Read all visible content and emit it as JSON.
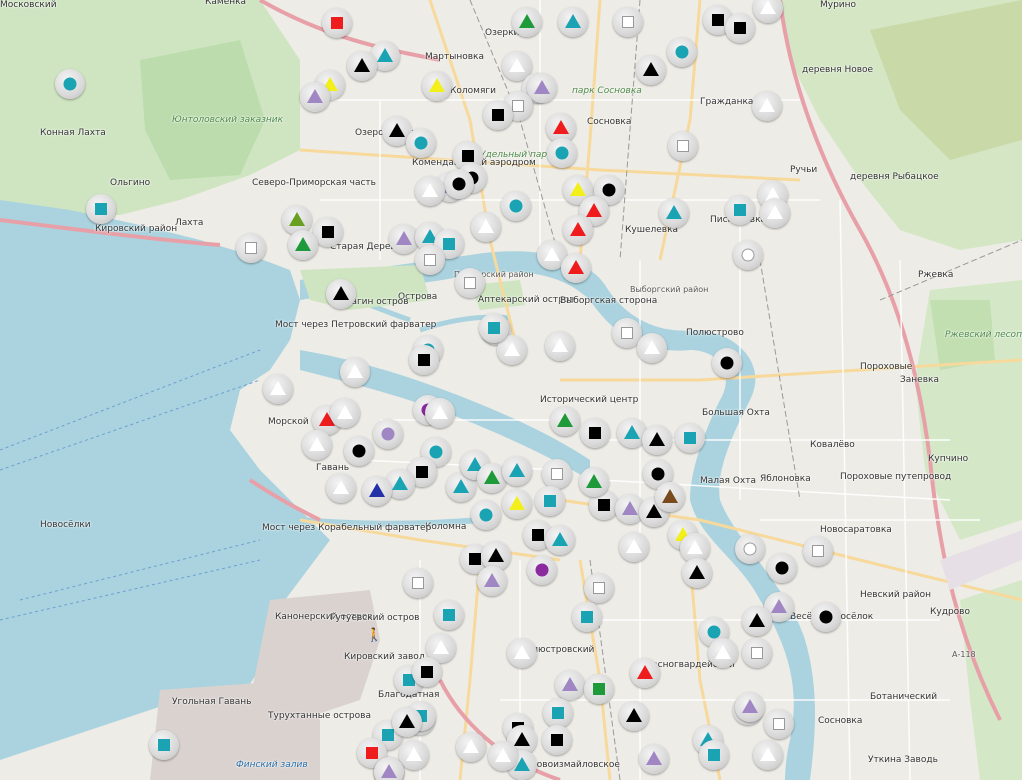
{
  "palette": {
    "teal": "#1aa3b3",
    "black": "#000000",
    "white": "#ffffff",
    "red": "#ee1c1c",
    "green": "#1f9a3a",
    "yellow": "#f2ef1a",
    "lavender": "#a087c4",
    "purple": "#8b2a9e",
    "blue": "#2430a8",
    "brown": "#7a4a1f",
    "olive": "#6aa022"
  },
  "labels": [
    {
      "text": "Каменка",
      "cls": ""
    },
    {
      "text": "Мурино",
      "cls": ""
    },
    {
      "text": "Озерки",
      "cls": ""
    },
    {
      "text": "деревня Новое",
      "cls": ""
    },
    {
      "text": "Мартыновка",
      "cls": ""
    },
    {
      "text": "Коломяги",
      "cls": ""
    },
    {
      "text": "парк Сосновка",
      "cls": "green"
    },
    {
      "text": "Гражданка",
      "cls": ""
    },
    {
      "text": "Конная Лахта",
      "cls": ""
    },
    {
      "text": "Юнтоловский заказник",
      "cls": "green"
    },
    {
      "text": "Озеро Долгое",
      "cls": ""
    },
    {
      "text": "Сосновка",
      "cls": ""
    },
    {
      "text": "Удельный парк",
      "cls": "green"
    },
    {
      "text": "Комендантский аэродром",
      "cls": ""
    },
    {
      "text": "Ручьи",
      "cls": ""
    },
    {
      "text": "деревня Рыбацкое",
      "cls": ""
    },
    {
      "text": "Ольгино",
      "cls": ""
    },
    {
      "text": "Северо-Приморская часть",
      "cls": ""
    },
    {
      "text": "Лахта",
      "cls": ""
    },
    {
      "text": "Старая Деревня",
      "cls": ""
    },
    {
      "text": "Кушелевка",
      "cls": ""
    },
    {
      "text": "Пискарёвка",
      "cls": ""
    },
    {
      "text": "Ржевка",
      "cls": ""
    },
    {
      "text": "Острова",
      "cls": ""
    },
    {
      "text": "Аптекарский остров",
      "cls": ""
    },
    {
      "text": "Выборгская сторона",
      "cls": ""
    },
    {
      "text": "Полюстрово",
      "cls": ""
    },
    {
      "text": "Елагин остров",
      "cls": ""
    },
    {
      "text": "Мост через Петровский фарватер",
      "cls": ""
    },
    {
      "text": "Ржевский лесопарк",
      "cls": "green"
    },
    {
      "text": "Пороховые",
      "cls": ""
    },
    {
      "text": "Большая Охта",
      "cls": ""
    },
    {
      "text": "Морской",
      "cls": ""
    },
    {
      "text": "Гавань",
      "cls": ""
    },
    {
      "text": "Малая Охта",
      "cls": ""
    },
    {
      "text": "Яблоновка",
      "cls": ""
    },
    {
      "text": "Пороховые путепровод",
      "cls": ""
    },
    {
      "text": "Ковалёво",
      "cls": ""
    },
    {
      "text": "Коломна",
      "cls": ""
    },
    {
      "text": "Мост через Корабельный фарватер",
      "cls": ""
    },
    {
      "text": "Кудрово",
      "cls": ""
    },
    {
      "text": "Весёлый Посёлок",
      "cls": ""
    },
    {
      "text": "Канонерский остров",
      "cls": ""
    },
    {
      "text": "Гутуевский остров",
      "cls": ""
    },
    {
      "text": "Кировский завод",
      "cls": ""
    },
    {
      "text": "Новосаратовка",
      "cls": ""
    },
    {
      "text": "Угольная Гавань",
      "cls": ""
    },
    {
      "text": "Турухтанные острова",
      "cls": ""
    },
    {
      "text": "Сосновка",
      "cls": ""
    },
    {
      "text": "Уткина Заводь",
      "cls": ""
    },
    {
      "text": "Исторический центр",
      "cls": ""
    },
    {
      "text": "А-118",
      "cls": "road"
    },
    {
      "text": "Новосёлки",
      "cls": ""
    },
    {
      "text": "Финский залив",
      "cls": "water"
    },
    {
      "text": "Кировский район",
      "cls": ""
    },
    {
      "text": "Приморский район",
      "cls": "road"
    },
    {
      "text": "Выборгский район",
      "cls": "road"
    },
    {
      "text": "Ботанический",
      "cls": ""
    },
    {
      "text": "Купчино",
      "cls": ""
    },
    {
      "text": "Заневка",
      "cls": ""
    },
    {
      "text": "Полюстровский",
      "cls": ""
    },
    {
      "text": "Благодатная",
      "cls": ""
    },
    {
      "text": "Новоизмайловское",
      "cls": ""
    },
    {
      "text": "Невский район",
      "cls": ""
    },
    {
      "text": "Красногвардейский",
      "cls": ""
    },
    {
      "text": "Московский",
      "cls": ""
    }
  ],
  "markers": [
    {
      "shape": "square",
      "color": "red"
    },
    {
      "shape": "triangle",
      "color": "green"
    },
    {
      "shape": "triangle",
      "color": "teal"
    },
    {
      "shape": "square",
      "color": "white"
    },
    {
      "shape": "square",
      "color": "black"
    },
    {
      "shape": "square",
      "color": "black"
    },
    {
      "shape": "triangle",
      "color": "white"
    },
    {
      "shape": "circle",
      "color": "teal"
    },
    {
      "shape": "triangle",
      "color": "teal"
    },
    {
      "shape": "triangle",
      "color": "black"
    },
    {
      "shape": "triangle",
      "color": "yellow"
    },
    {
      "shape": "triangle",
      "color": "yellow"
    },
    {
      "shape": "triangle",
      "color": "white"
    },
    {
      "shape": "triangle",
      "color": "black"
    },
    {
      "shape": "circle",
      "color": "teal"
    },
    {
      "shape": "triangle",
      "color": "white"
    },
    {
      "shape": "triangle",
      "color": "lavender"
    },
    {
      "shape": "triangle",
      "color": "lavender"
    },
    {
      "shape": "square",
      "color": "white"
    },
    {
      "shape": "square",
      "color": "black"
    },
    {
      "shape": "triangle",
      "color": "white"
    },
    {
      "shape": "triangle",
      "color": "red"
    },
    {
      "shape": "triangle",
      "color": "black"
    },
    {
      "shape": "circle",
      "color": "teal"
    },
    {
      "shape": "circle",
      "color": "teal"
    },
    {
      "shape": "square",
      "color": "white"
    },
    {
      "shape": "square",
      "color": "black"
    },
    {
      "shape": "triangle",
      "color": "lavender"
    },
    {
      "shape": "circle",
      "color": "black"
    },
    {
      "shape": "circle",
      "color": "black"
    },
    {
      "shape": "triangle",
      "color": "yellow"
    },
    {
      "shape": "circle",
      "color": "black"
    },
    {
      "shape": "square",
      "color": "teal"
    },
    {
      "shape": "triangle",
      "color": "white"
    },
    {
      "shape": "circle",
      "color": "teal"
    },
    {
      "shape": "triangle",
      "color": "red"
    },
    {
      "shape": "triangle",
      "color": "teal"
    },
    {
      "shape": "square",
      "color": "teal"
    },
    {
      "shape": "triangle",
      "color": "white"
    },
    {
      "shape": "triangle",
      "color": "olive"
    },
    {
      "shape": "square",
      "color": "black"
    },
    {
      "shape": "triangle",
      "color": "green"
    },
    {
      "shape": "square",
      "color": "white"
    },
    {
      "shape": "triangle",
      "color": "lavender"
    },
    {
      "shape": "triangle",
      "color": "teal"
    },
    {
      "shape": "square",
      "color": "teal"
    },
    {
      "shape": "triangle",
      "color": "white"
    },
    {
      "shape": "triangle",
      "color": "red"
    },
    {
      "shape": "triangle",
      "color": "white"
    },
    {
      "shape": "triangle",
      "color": "red"
    },
    {
      "shape": "circle",
      "color": "white"
    },
    {
      "shape": "triangle",
      "color": "white"
    },
    {
      "shape": "square",
      "color": "white"
    },
    {
      "shape": "triangle",
      "color": "black"
    },
    {
      "shape": "circle",
      "color": "teal"
    },
    {
      "shape": "square",
      "color": "white"
    },
    {
      "shape": "square",
      "color": "white"
    },
    {
      "shape": "triangle",
      "color": "white"
    },
    {
      "shape": "square",
      "color": "black"
    },
    {
      "shape": "triangle",
      "color": "white"
    },
    {
      "shape": "circle",
      "color": "black"
    },
    {
      "shape": "triangle",
      "color": "white"
    },
    {
      "shape": "triangle",
      "color": "white"
    },
    {
      "shape": "square",
      "color": "teal"
    },
    {
      "shape": "triangle",
      "color": "white"
    },
    {
      "shape": "triangle",
      "color": "red"
    },
    {
      "shape": "triangle",
      "color": "white"
    },
    {
      "shape": "circle",
      "color": "purple"
    },
    {
      "shape": "circle",
      "color": "lavender"
    },
    {
      "shape": "triangle",
      "color": "white"
    },
    {
      "shape": "circle",
      "color": "teal"
    },
    {
      "shape": "triangle",
      "color": "white"
    },
    {
      "shape": "triangle",
      "color": "white"
    },
    {
      "shape": "triangle",
      "color": "green"
    },
    {
      "shape": "square",
      "color": "black"
    },
    {
      "shape": "triangle",
      "color": "teal"
    },
    {
      "shape": "triangle",
      "color": "black"
    },
    {
      "shape": "square",
      "color": "teal"
    },
    {
      "shape": "circle",
      "color": "black"
    },
    {
      "shape": "triangle",
      "color": "white"
    },
    {
      "shape": "square",
      "color": "black"
    },
    {
      "shape": "triangle",
      "color": "teal"
    },
    {
      "shape": "square",
      "color": "white"
    },
    {
      "shape": "triangle",
      "color": "blue"
    },
    {
      "shape": "triangle",
      "color": "teal"
    },
    {
      "shape": "triangle",
      "color": "teal"
    },
    {
      "shape": "triangle",
      "color": "green"
    },
    {
      "shape": "triangle",
      "color": "yellow"
    },
    {
      "shape": "square",
      "color": "teal"
    },
    {
      "shape": "triangle",
      "color": "teal"
    },
    {
      "shape": "square",
      "color": "black"
    },
    {
      "shape": "triangle",
      "color": "green"
    },
    {
      "shape": "triangle",
      "color": "lavender"
    },
    {
      "shape": "triangle",
      "color": "black"
    },
    {
      "shape": "circle",
      "color": "black"
    },
    {
      "shape": "triangle",
      "color": "brown"
    },
    {
      "shape": "circle",
      "color": "teal"
    },
    {
      "shape": "square",
      "color": "black"
    },
    {
      "shape": "triangle",
      "color": "teal"
    },
    {
      "shape": "triangle",
      "color": "white"
    },
    {
      "shape": "triangle",
      "color": "yellow"
    },
    {
      "shape": "triangle",
      "color": "white"
    },
    {
      "shape": "circle",
      "color": "white"
    },
    {
      "shape": "square",
      "color": "white"
    },
    {
      "shape": "square",
      "color": "black"
    },
    {
      "shape": "triangle",
      "color": "black"
    },
    {
      "shape": "circle",
      "color": "purple"
    },
    {
      "shape": "triangle",
      "color": "lavender"
    },
    {
      "shape": "square",
      "color": "white"
    },
    {
      "shape": "square",
      "color": "white"
    },
    {
      "shape": "triangle",
      "color": "black"
    },
    {
      "shape": "circle",
      "color": "black"
    },
    {
      "shape": "triangle",
      "color": "lavender"
    },
    {
      "shape": "circle",
      "color": "black"
    },
    {
      "shape": "triangle",
      "color": "black"
    },
    {
      "shape": "square",
      "color": "teal"
    },
    {
      "shape": "circle",
      "color": "teal"
    },
    {
      "shape": "square",
      "color": "teal"
    },
    {
      "shape": "square",
      "color": "teal"
    },
    {
      "shape": "triangle",
      "color": "white"
    },
    {
      "shape": "triangle",
      "color": "white"
    },
    {
      "shape": "square",
      "color": "white"
    },
    {
      "shape": "triangle",
      "color": "red"
    },
    {
      "shape": "square",
      "color": "black"
    },
    {
      "shape": "triangle",
      "color": "white"
    },
    {
      "shape": "square",
      "color": "teal"
    },
    {
      "shape": "triangle",
      "color": "lavender"
    },
    {
      "shape": "square",
      "color": "green"
    },
    {
      "shape": "square",
      "color": "teal"
    },
    {
      "shape": "triangle",
      "color": "black"
    },
    {
      "shape": "triangle",
      "color": "teal"
    },
    {
      "shape": "triangle",
      "color": "lavender"
    },
    {
      "shape": "square",
      "color": "white"
    },
    {
      "shape": "square",
      "color": "teal"
    },
    {
      "shape": "square",
      "color": "teal"
    },
    {
      "shape": "triangle",
      "color": "black"
    },
    {
      "shape": "square",
      "color": "red"
    },
    {
      "shape": "triangle",
      "color": "white"
    },
    {
      "shape": "triangle",
      "color": "white"
    },
    {
      "shape": "square",
      "color": "black"
    },
    {
      "shape": "triangle",
      "color": "black"
    },
    {
      "shape": "triangle",
      "color": "teal"
    },
    {
      "shape": "square",
      "color": "black"
    },
    {
      "shape": "triangle",
      "color": "white"
    },
    {
      "shape": "triangle",
      "color": "teal"
    },
    {
      "shape": "square",
      "color": "teal"
    },
    {
      "shape": "triangle",
      "color": "white"
    },
    {
      "shape": "square",
      "color": "teal"
    },
    {
      "shape": "triangle",
      "color": "teal"
    },
    {
      "shape": "triangle",
      "color": "lavender"
    },
    {
      "shape": "triangle",
      "color": "lavender"
    }
  ],
  "walker_icon": "pedestrian-icon"
}
